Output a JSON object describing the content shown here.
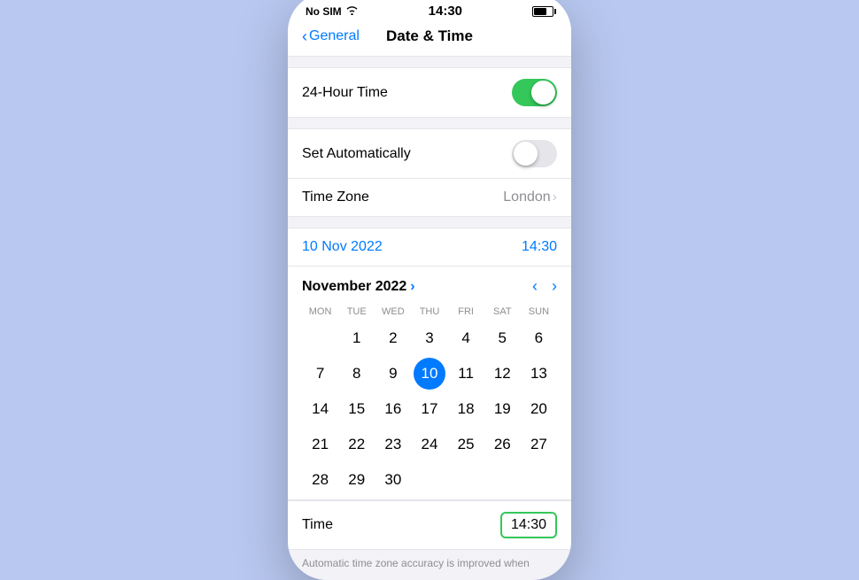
{
  "statusBar": {
    "carrier": "No SIM",
    "time": "14:30",
    "wifiIcon": "wifi",
    "batteryIcon": "battery"
  },
  "navBar": {
    "backLabel": "General",
    "title": "Date & Time"
  },
  "settings": {
    "section1": {
      "rows": [
        {
          "label": "24-Hour Time",
          "type": "toggle",
          "value": true
        }
      ]
    },
    "section2": {
      "rows": [
        {
          "label": "Set Automatically",
          "type": "toggle",
          "value": false
        },
        {
          "label": "Time Zone",
          "type": "timezone",
          "value": "London"
        }
      ]
    },
    "dateTimeDisplay": {
      "date": "10 Nov 2022",
      "time": "14:30"
    },
    "calendar": {
      "monthTitle": "November 2022",
      "chevron": "›",
      "dayHeaders": [
        "MON",
        "TUE",
        "WED",
        "THU",
        "FRI",
        "SAT",
        "SUN"
      ],
      "weeks": [
        [
          null,
          1,
          2,
          3,
          4,
          5,
          6
        ],
        [
          7,
          8,
          9,
          10,
          11,
          12,
          13
        ],
        [
          14,
          15,
          16,
          17,
          18,
          19,
          20
        ],
        [
          21,
          22,
          23,
          24,
          25,
          26,
          27
        ],
        [
          28,
          29,
          30,
          null,
          null,
          null,
          null
        ]
      ],
      "selectedDay": 10
    },
    "timeRow": {
      "label": "Time",
      "value": "14:30"
    },
    "footerNote": "Automatic time zone accuracy is improved when"
  }
}
